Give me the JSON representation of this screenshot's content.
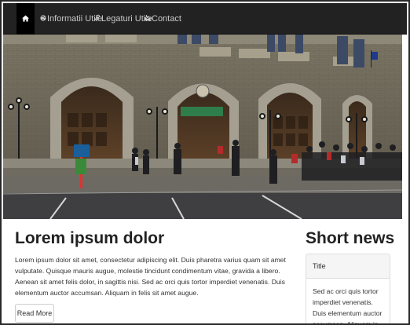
{
  "navbar": {
    "home_icon": "home-icon",
    "items": [
      {
        "label": "Informatii Utile",
        "icon": "globe-icon"
      },
      {
        "label": "Legaturi Utile",
        "icon": "link-icon"
      },
      {
        "label": "Contact",
        "icon": "envelope-icon"
      }
    ]
  },
  "hero": {
    "sign_text": "BLIZZARD RESTAURANT",
    "banner_color": "#2f7d4a"
  },
  "main": {
    "title": "Lorem ipsum dolor",
    "body": "Lorem ipsum dolor sit amet, consectetur adipiscing elit. Duis pharetra varius quam sit amet vulputate. Quisque mauris augue, molestie tincidunt condimentum vitae, gravida a libero. Aenean sit amet felis dolor, in sagittis nisi. Sed ac orci quis tortor imperdiet venenatis. Duis elementum auctor accumsan. Aliquam in felis sit amet augue.",
    "button_label": "Read More"
  },
  "sidebar": {
    "title": "Short news",
    "panel_heading": "Title",
    "panel_body": "Sed ac orci quis tortor imperdiet venenatis. Duis elementum auctor accumsan. Aliquam in felis sit amet augue."
  }
}
